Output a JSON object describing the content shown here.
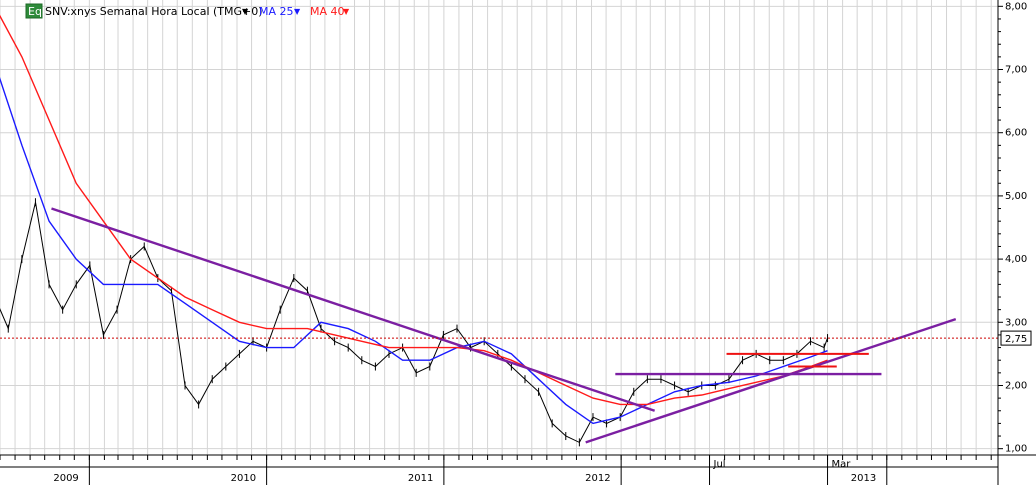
{
  "header": {
    "badge": "Eq",
    "symbol_label": "SNV:xnys Semanal Hora Local (TMG+0)",
    "ma25_label": "MA 25",
    "ma40_label": "MA 40"
  },
  "price_badge": "2,75",
  "colors": {
    "price": "#000000",
    "ma25": "#1a1aff",
    "ma40": "#ff1a1a",
    "trend": "#7b1fa2",
    "level": "#ee1111",
    "grid": "#d4d4d4",
    "badge_bg": "#2e8b3a"
  },
  "chart_data": {
    "type": "candlestick",
    "title": "SNV:xnys Semanal Hora Local (TMG+0)",
    "x_labels": [
      {
        "label": "2009",
        "date": "2009-01-01"
      },
      {
        "label": "2010",
        "date": "2010-01-01"
      },
      {
        "label": "2011",
        "date": "2011-01-01"
      },
      {
        "label": "2012",
        "date": "2012-01-01"
      },
      {
        "label": "Jul",
        "date": "2012-07-01"
      },
      {
        "label": "Mar",
        "date": "2013-03-01"
      },
      {
        "label": "2013",
        "date": "2013-07-01"
      }
    ],
    "x_range": [
      "2008-07-01",
      "2014-02-15"
    ],
    "y_ticks": [
      "1,00",
      "2,00",
      "3,00",
      "4,00",
      "5,00",
      "6,00",
      "7,00",
      "8,00"
    ],
    "y_range": [
      0.9,
      8.1
    ],
    "grid": true,
    "current_price": 2.75,
    "series": [
      {
        "name": "SNV:xnys",
        "kind": "price",
        "points": [
          [
            "2008-06-20",
            3.4
          ],
          [
            "2008-07-18",
            2.9
          ],
          [
            "2008-08-15",
            4.0
          ],
          [
            "2008-09-12",
            4.9
          ],
          [
            "2008-10-10",
            3.6
          ],
          [
            "2008-11-07",
            3.2
          ],
          [
            "2008-12-05",
            3.6
          ],
          [
            "2009-01-02",
            3.9
          ],
          [
            "2009-01-30",
            2.8
          ],
          [
            "2009-02-27",
            3.2
          ],
          [
            "2009-03-27",
            4.0
          ],
          [
            "2009-04-24",
            4.2
          ],
          [
            "2009-05-22",
            3.7
          ],
          [
            "2009-06-19",
            3.5
          ],
          [
            "2009-07-17",
            2.0
          ],
          [
            "2009-08-14",
            1.7
          ],
          [
            "2009-09-11",
            2.1
          ],
          [
            "2009-10-09",
            2.3
          ],
          [
            "2009-11-06",
            2.5
          ],
          [
            "2009-12-04",
            2.7
          ],
          [
            "2010-01-01",
            2.6
          ],
          [
            "2010-01-29",
            3.2
          ],
          [
            "2010-02-26",
            3.7
          ],
          [
            "2010-03-26",
            3.5
          ],
          [
            "2010-04-23",
            2.9
          ],
          [
            "2010-05-21",
            2.7
          ],
          [
            "2010-06-18",
            2.6
          ],
          [
            "2010-07-16",
            2.4
          ],
          [
            "2010-08-13",
            2.3
          ],
          [
            "2010-09-10",
            2.5
          ],
          [
            "2010-10-08",
            2.6
          ],
          [
            "2010-11-05",
            2.2
          ],
          [
            "2010-12-03",
            2.3
          ],
          [
            "2010-12-31",
            2.8
          ],
          [
            "2011-01-28",
            2.9
          ],
          [
            "2011-02-25",
            2.6
          ],
          [
            "2011-03-25",
            2.7
          ],
          [
            "2011-04-22",
            2.5
          ],
          [
            "2011-05-20",
            2.3
          ],
          [
            "2011-06-17",
            2.1
          ],
          [
            "2011-07-15",
            1.9
          ],
          [
            "2011-08-12",
            1.4
          ],
          [
            "2011-09-09",
            1.2
          ],
          [
            "2011-10-07",
            1.1
          ],
          [
            "2011-11-04",
            1.5
          ],
          [
            "2011-12-02",
            1.4
          ],
          [
            "2011-12-30",
            1.5
          ],
          [
            "2012-01-27",
            1.9
          ],
          [
            "2012-02-24",
            2.1
          ],
          [
            "2012-03-23",
            2.1
          ],
          [
            "2012-04-20",
            2.0
          ],
          [
            "2012-05-18",
            1.9
          ],
          [
            "2012-06-15",
            2.0
          ],
          [
            "2012-07-13",
            2.0
          ],
          [
            "2012-08-10",
            2.1
          ],
          [
            "2012-09-07",
            2.4
          ],
          [
            "2012-10-05",
            2.5
          ],
          [
            "2012-11-02",
            2.4
          ],
          [
            "2012-11-30",
            2.4
          ],
          [
            "2012-12-28",
            2.5
          ],
          [
            "2013-01-25",
            2.7
          ],
          [
            "2013-02-22",
            2.6
          ],
          [
            "2013-03-01",
            2.75
          ]
        ]
      },
      {
        "name": "MA 25",
        "kind": "line",
        "points": [
          [
            "2008-06-20",
            7.1
          ],
          [
            "2008-08-15",
            5.8
          ],
          [
            "2008-10-10",
            4.6
          ],
          [
            "2008-12-05",
            4.0
          ],
          [
            "2009-01-30",
            3.6
          ],
          [
            "2009-03-27",
            3.6
          ],
          [
            "2009-05-22",
            3.6
          ],
          [
            "2009-07-17",
            3.3
          ],
          [
            "2009-09-11",
            3.0
          ],
          [
            "2009-11-06",
            2.7
          ],
          [
            "2010-01-01",
            2.6
          ],
          [
            "2010-02-26",
            2.6
          ],
          [
            "2010-04-23",
            3.0
          ],
          [
            "2010-06-18",
            2.9
          ],
          [
            "2010-08-13",
            2.7
          ],
          [
            "2010-10-08",
            2.4
          ],
          [
            "2010-12-03",
            2.4
          ],
          [
            "2011-01-28",
            2.6
          ],
          [
            "2011-03-25",
            2.7
          ],
          [
            "2011-05-20",
            2.5
          ],
          [
            "2011-07-15",
            2.1
          ],
          [
            "2011-09-09",
            1.7
          ],
          [
            "2011-11-04",
            1.4
          ],
          [
            "2011-12-30",
            1.5
          ],
          [
            "2012-02-24",
            1.7
          ],
          [
            "2012-04-20",
            1.9
          ],
          [
            "2012-06-15",
            2.0
          ],
          [
            "2012-08-10",
            2.05
          ],
          [
            "2012-10-05",
            2.15
          ],
          [
            "2012-11-30",
            2.3
          ],
          [
            "2013-01-25",
            2.45
          ],
          [
            "2013-03-01",
            2.55
          ]
        ]
      },
      {
        "name": "MA 40",
        "kind": "line",
        "points": [
          [
            "2008-06-20",
            8.0
          ],
          [
            "2008-08-15",
            7.2
          ],
          [
            "2008-10-10",
            6.2
          ],
          [
            "2008-12-05",
            5.2
          ],
          [
            "2009-01-30",
            4.6
          ],
          [
            "2009-03-27",
            4.0
          ],
          [
            "2009-05-22",
            3.7
          ],
          [
            "2009-07-17",
            3.4
          ],
          [
            "2009-09-11",
            3.2
          ],
          [
            "2009-11-06",
            3.0
          ],
          [
            "2010-01-01",
            2.9
          ],
          [
            "2010-03-26",
            2.9
          ],
          [
            "2010-05-21",
            2.8
          ],
          [
            "2010-07-16",
            2.7
          ],
          [
            "2010-09-10",
            2.6
          ],
          [
            "2010-11-05",
            2.6
          ],
          [
            "2011-01-28",
            2.6
          ],
          [
            "2011-03-25",
            2.55
          ],
          [
            "2011-05-20",
            2.4
          ],
          [
            "2011-07-15",
            2.2
          ],
          [
            "2011-09-09",
            2.0
          ],
          [
            "2011-11-04",
            1.8
          ],
          [
            "2011-12-30",
            1.7
          ],
          [
            "2012-02-24",
            1.7
          ],
          [
            "2012-04-20",
            1.8
          ],
          [
            "2012-06-15",
            1.85
          ],
          [
            "2012-08-10",
            1.95
          ],
          [
            "2012-10-05",
            2.05
          ],
          [
            "2012-11-30",
            2.15
          ],
          [
            "2013-01-25",
            2.3
          ],
          [
            "2013-03-01",
            2.4
          ]
        ]
      }
    ],
    "trendlines": [
      {
        "kind": "trend",
        "points": [
          [
            "2008-10-15",
            4.8
          ],
          [
            "2012-03-10",
            1.6
          ]
        ]
      },
      {
        "kind": "trend",
        "points": [
          [
            "2011-10-20",
            1.1
          ],
          [
            "2013-11-20",
            3.05
          ]
        ]
      },
      {
        "kind": "trend",
        "points": [
          [
            "2011-12-20",
            2.18
          ],
          [
            "2013-06-20",
            2.18
          ]
        ]
      },
      {
        "kind": "level",
        "points": [
          [
            "2012-08-05",
            2.5
          ],
          [
            "2013-05-25",
            2.5
          ]
        ]
      },
      {
        "kind": "level",
        "points": [
          [
            "2012-12-10",
            2.3
          ],
          [
            "2013-03-20",
            2.3
          ]
        ]
      }
    ]
  }
}
